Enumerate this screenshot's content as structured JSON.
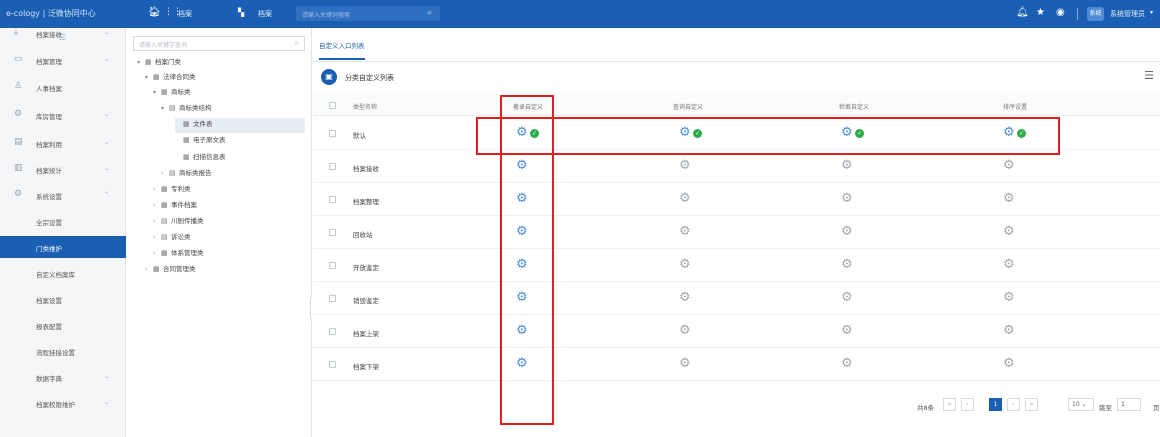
{
  "topbar": {
    "brand": "e-cology | 泛微协同中心",
    "module": "档案",
    "scope": "档案",
    "search_placeholder": "请输入关键词搜索",
    "avatar_text": "系统",
    "user": "系统管理员"
  },
  "left_menu": {
    "items": [
      {
        "icon": "download-icon",
        "glyph": "⤓",
        "label": "档案接收",
        "chev": "⌄"
      },
      {
        "icon": "folder-icon",
        "glyph": "▭",
        "label": "档案管理",
        "chev": "⌄"
      },
      {
        "icon": "person-icon",
        "glyph": "♙",
        "label": "人事档案",
        "chev": ""
      },
      {
        "icon": "gear-icon",
        "glyph": "⚙",
        "label": "库房管理",
        "chev": "⌄"
      },
      {
        "icon": "document-icon",
        "glyph": "▤",
        "label": "档案利用",
        "chev": "⌄"
      },
      {
        "icon": "chart-icon",
        "glyph": "▥",
        "label": "档案统计",
        "chev": "⌄"
      },
      {
        "icon": "settings-icon",
        "glyph": "⚙",
        "label": "系统设置",
        "chev": "⌃"
      },
      {
        "icon": "",
        "glyph": "",
        "label": "全宗设置",
        "chev": ""
      },
      {
        "icon": "",
        "glyph": "",
        "label": "门类维护",
        "chev": ""
      },
      {
        "icon": "",
        "glyph": "",
        "label": "自定义档案库",
        "chev": ""
      },
      {
        "icon": "",
        "glyph": "",
        "label": "档案设置",
        "chev": ""
      },
      {
        "icon": "",
        "glyph": "",
        "label": "报表配置",
        "chev": ""
      },
      {
        "icon": "",
        "glyph": "",
        "label": "流程挂接设置",
        "chev": ""
      },
      {
        "icon": "",
        "glyph": "",
        "label": "数据字典",
        "chev": "⌄"
      },
      {
        "icon": "",
        "glyph": "",
        "label": "档案权限维护",
        "chev": "⌄"
      }
    ]
  },
  "tree": {
    "search_placeholder": "请输入关键字查询",
    "nodes": [
      {
        "arrow": "▾",
        "icon": "▦",
        "label": "档案门类"
      },
      {
        "arrow": "▾",
        "icon": "▦",
        "label": "法律合同类"
      },
      {
        "arrow": "▾",
        "icon": "▦",
        "label": "商标类"
      },
      {
        "arrow": "▾",
        "icon": "▤",
        "label": "商标类结构"
      },
      {
        "arrow": "",
        "icon": "▦",
        "label": "文件表"
      },
      {
        "arrow": "",
        "icon": "▦",
        "label": "电子原文表"
      },
      {
        "arrow": "",
        "icon": "▦",
        "label": "扫描信息表"
      },
      {
        "arrow": "›",
        "icon": "▤",
        "label": "商标类报告"
      },
      {
        "arrow": "›",
        "icon": "▦",
        "label": "专利类"
      },
      {
        "arrow": "›",
        "icon": "▦",
        "label": "事件档案"
      },
      {
        "arrow": "›",
        "icon": "▤",
        "label": "川剧传播类"
      },
      {
        "arrow": "›",
        "icon": "▤",
        "label": "诉讼类"
      },
      {
        "arrow": "›",
        "icon": "▦",
        "label": "体系管理类"
      },
      {
        "arrow": "›",
        "icon": "▦",
        "label": "合同管理类"
      }
    ]
  },
  "main": {
    "tab": "自定义入口列表",
    "page_title": "分类自定义列表",
    "columns": [
      "类型名称",
      "著录自定义",
      "查询自定义",
      "检索自定义",
      "排序设置"
    ],
    "rows": [
      {
        "name": "默认",
        "states": [
          true,
          true,
          true,
          true
        ]
      },
      {
        "name": "档案接收",
        "states": [
          false,
          false,
          false,
          false
        ]
      },
      {
        "name": "档案整理",
        "states": [
          false,
          false,
          false,
          false
        ]
      },
      {
        "name": "回收站",
        "states": [
          false,
          false,
          false,
          false
        ]
      },
      {
        "name": "开放鉴定",
        "states": [
          false,
          false,
          false,
          false
        ]
      },
      {
        "name": "销毁鉴定",
        "states": [
          false,
          false,
          false,
          false
        ]
      },
      {
        "name": "档案上架",
        "states": [
          false,
          false,
          false,
          false
        ]
      },
      {
        "name": "档案下架",
        "states": [
          false,
          false,
          false,
          false
        ]
      }
    ]
  },
  "pager": {
    "total": "共8条",
    "current_page": "1",
    "page_size": "10 ⌄",
    "goto_label": "跳至",
    "goto_value": "1",
    "unit": "页"
  },
  "colors": {
    "topbar": "#1a5fb4",
    "highlight": "#e02020",
    "gear_active": "#4a8fd8",
    "gear_inactive": "#a4a9b0",
    "check": "#2eaa4a"
  }
}
